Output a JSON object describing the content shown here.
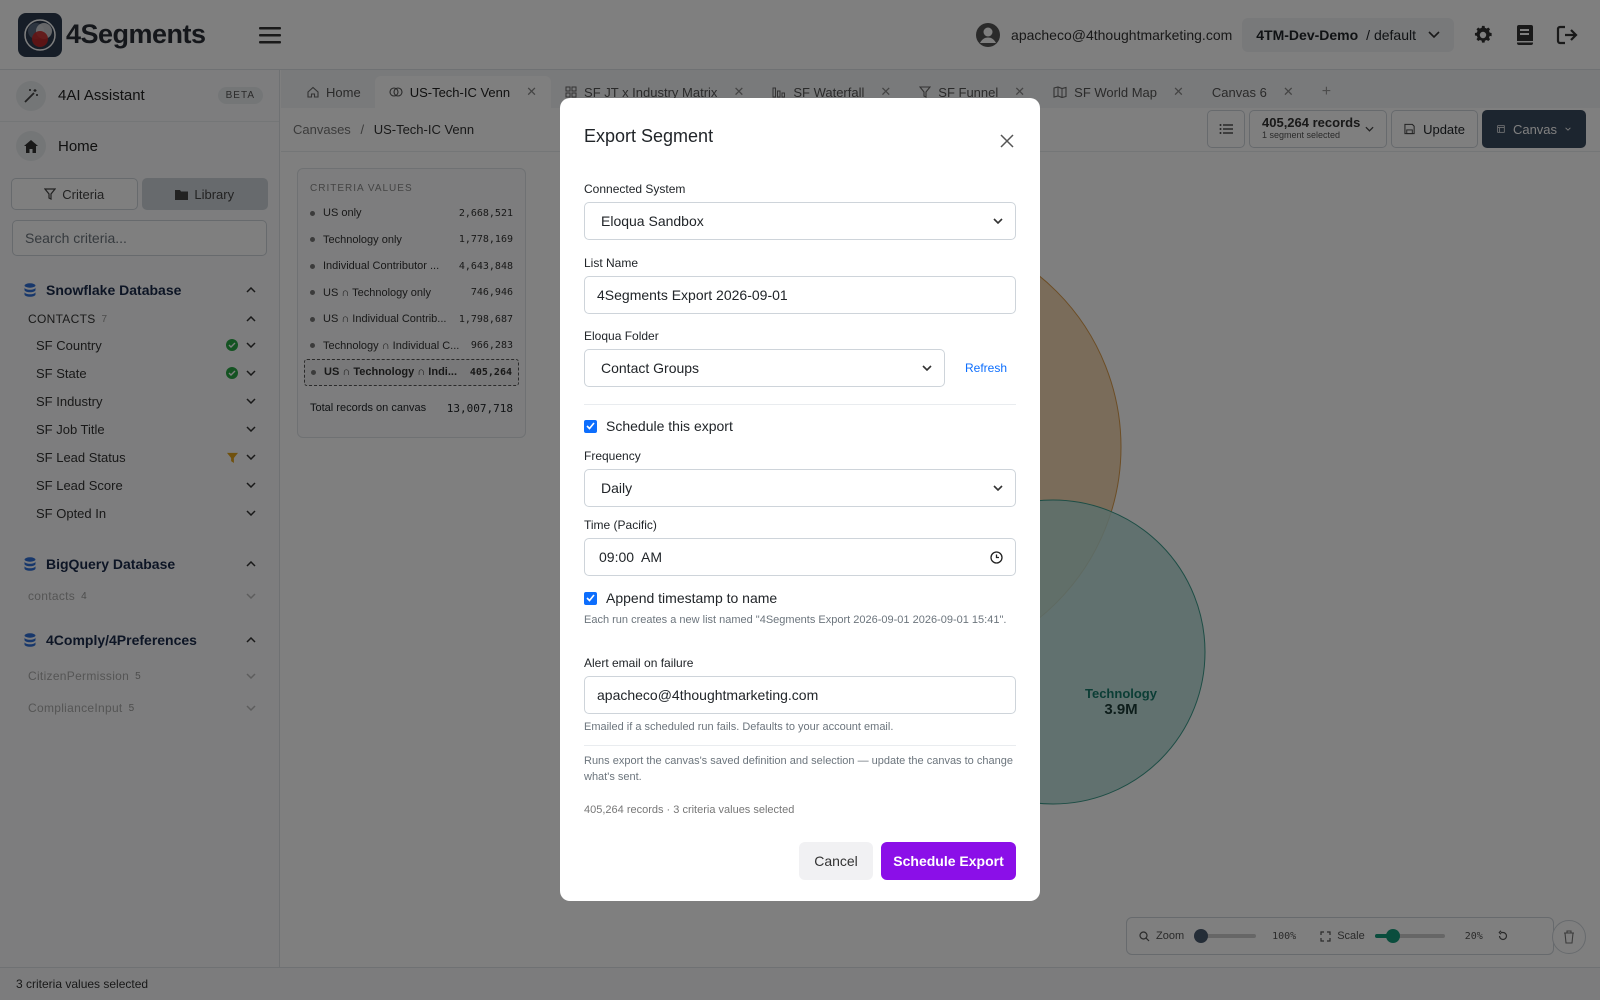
{
  "header": {
    "brand": "4Segments",
    "user_email": "apacheco@4thoughtmarketing.com",
    "tenant": "4TM-Dev-Demo",
    "tenant_suffix": "/ default"
  },
  "sidebar": {
    "assistant_label": "4AI Assistant",
    "beta_label": "BETA",
    "home_label": "Home",
    "criteria_btn": "Criteria",
    "library_btn": "Library",
    "search_placeholder": "Search criteria...",
    "databases": [
      {
        "name": "Snowflake Database",
        "group": "CONTACTS",
        "group_count": "7",
        "items": [
          "SF Country",
          "SF State",
          "SF Industry",
          "SF Job Title",
          "SF Lead Status",
          "SF Lead Score",
          "SF Opted In"
        ]
      },
      {
        "name": "BigQuery Database",
        "groups": [
          {
            "name": "contacts",
            "count": "4"
          }
        ]
      },
      {
        "name": "4Comply/4Preferences",
        "groups": [
          {
            "name": "CitizenPermission",
            "count": "5"
          },
          {
            "name": "ComplianceInput",
            "count": "5"
          }
        ]
      }
    ]
  },
  "tabs": [
    {
      "label": "Home",
      "icon": "home-icon"
    },
    {
      "label": "US-Tech-IC Venn",
      "icon": "venn-icon",
      "active": true
    },
    {
      "label": "SF JT x Industry Matrix",
      "icon": "grid-icon"
    },
    {
      "label": "SF Waterfall",
      "icon": "bars-icon"
    },
    {
      "label": "SF Funnel",
      "icon": "funnel-icon"
    },
    {
      "label": "SF World Map",
      "icon": "map-icon"
    },
    {
      "label": "Canvas 6",
      "icon": ""
    }
  ],
  "tab_add": "+",
  "breadcrumb": {
    "root": "Canvases",
    "sep": "/",
    "current": "US-Tech-IC Venn"
  },
  "toolbar": {
    "records": "405,264 records",
    "records_sub": "1 segment selected",
    "update_label": "Update",
    "canvas_label": "Canvas"
  },
  "criteria_panel": {
    "title": "CRITERIA VALUES",
    "rows": [
      {
        "label": "US only",
        "value": "2,668,521"
      },
      {
        "label": "Technology only",
        "value": "1,778,169"
      },
      {
        "label": "Individual Contributor ...",
        "value": "4,643,848"
      },
      {
        "label": "US ∩ Technology only",
        "value": "746,946"
      },
      {
        "label": "US ∩ Individual Contrib...",
        "value": "1,798,687"
      },
      {
        "label": "Technology ∩ Individual C...",
        "value": "966,283"
      },
      {
        "label": "US ∩ Technology ∩ Indi...",
        "value": "405,264",
        "selected": true
      }
    ],
    "total_label": "Total records on canvas",
    "total_value": "13,007,718"
  },
  "venn": {
    "technology_label": "Technology",
    "technology_value": "3.9M"
  },
  "zoom_bar": {
    "zoom_label": "Zoom",
    "zoom_value": "100%",
    "scale_label": "Scale",
    "scale_value": "20%",
    "zoom_level": 0.0,
    "scale_level": 0.2
  },
  "status_bar": "3 criteria values selected",
  "modal": {
    "title": "Export Segment",
    "connected_system_label": "Connected System",
    "connected_system_value": "Eloqua Sandbox",
    "list_name_label": "List Name",
    "list_name_value": "4Segments Export 2026-09-01",
    "folder_label": "Eloqua Folder",
    "folder_value": "Contact Groups",
    "refresh_label": "Refresh",
    "schedule_label": "Schedule this export",
    "frequency_label": "Frequency",
    "frequency_value": "Daily",
    "time_label": "Time (Pacific)",
    "time_value": "09:00  AM",
    "append_label": "Append timestamp to name",
    "append_help": "Each run creates a new list named \"4Segments Export 2026-09-01 2026-09-01 15:41\".",
    "alert_label": "Alert email on failure",
    "alert_value": "apacheco@4thoughtmarketing.com",
    "alert_help": "Emailed if a scheduled run fails. Defaults to your account email.",
    "note": "Runs export the canvas's saved definition and selection — update the canvas to change what's sent.",
    "summary": "405,264 records · 3 criteria values selected",
    "cancel_label": "Cancel",
    "submit_label": "Schedule Export",
    "colors": {
      "primary": "#8b0fe8",
      "checkbox": "#0d6efd"
    }
  }
}
